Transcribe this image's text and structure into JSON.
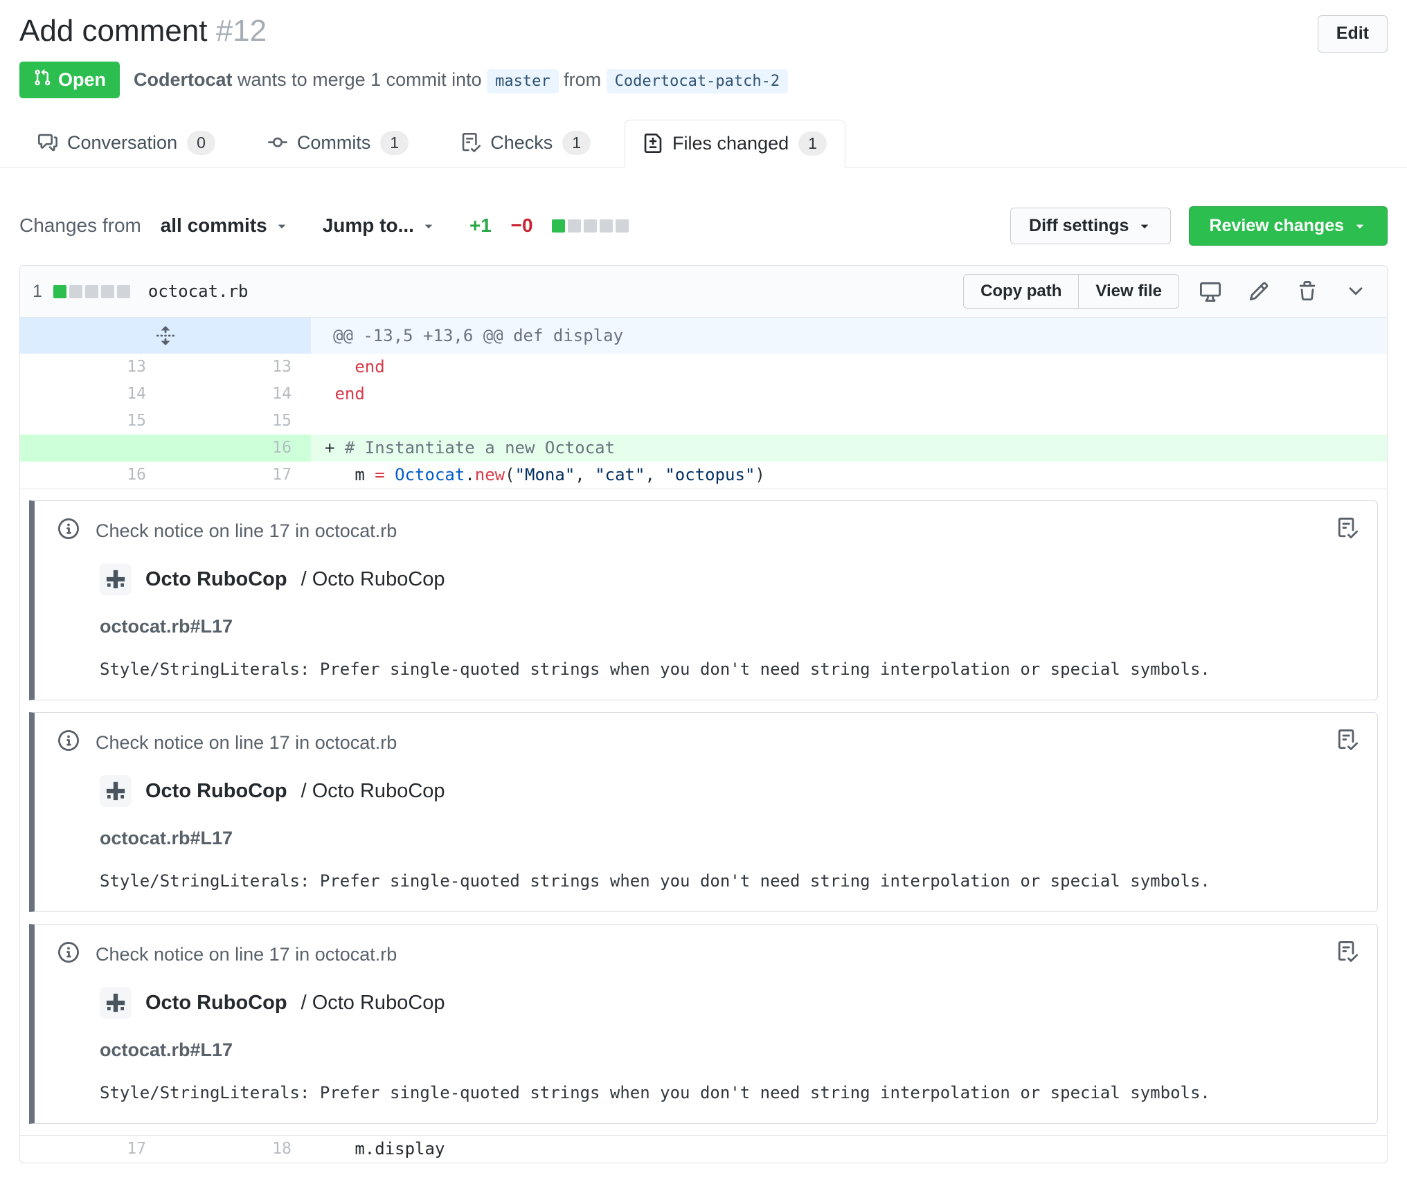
{
  "header": {
    "title": "Add comment",
    "number": "#12",
    "edit_button": "Edit",
    "state_label": "Open",
    "meta": {
      "author": "Codertocat",
      "text_middle": " wants to merge 1 commit into ",
      "base_branch": "master",
      "text_from": " from ",
      "head_branch": "Codertocat-patch-2"
    }
  },
  "tabs": [
    {
      "label": "Conversation",
      "count": "0",
      "icon": "comment-discussion",
      "active": false
    },
    {
      "label": "Commits",
      "count": "1",
      "icon": "git-commit",
      "active": false
    },
    {
      "label": "Checks",
      "count": "1",
      "icon": "checklist",
      "active": false
    },
    {
      "label": "Files changed",
      "count": "1",
      "icon": "file-diff",
      "active": true
    }
  ],
  "toolbar": {
    "changes_from_label": "Changes from",
    "changes_from_value": "all commits",
    "jump_to": "Jump to...",
    "additions": "+1",
    "deletions": "−0",
    "diff_blocks": {
      "added": 1,
      "total": 5
    },
    "diff_settings": "Diff settings",
    "review_changes": "Review changes"
  },
  "file": {
    "changed_count": "1",
    "blocks": {
      "added": 1,
      "total": 5
    },
    "name": "octocat.rb",
    "copy_path": "Copy path",
    "view_file": "View file"
  },
  "diff": {
    "hunk": {
      "header": "@@ -13,5 +13,6 @@ def display"
    },
    "rows": [
      {
        "type": "context",
        "old": "13",
        "new": "13",
        "tokens": [
          {
            "t": "   ",
            "c": "fg"
          },
          {
            "t": "end",
            "c": "kw"
          }
        ]
      },
      {
        "type": "context",
        "old": "14",
        "new": "14",
        "tokens": [
          {
            "t": " ",
            "c": "fg"
          },
          {
            "t": "end",
            "c": "kw"
          }
        ]
      },
      {
        "type": "context",
        "old": "15",
        "new": "15",
        "tokens": []
      },
      {
        "type": "add",
        "old": "",
        "new": "16",
        "tokens": [
          {
            "t": "+ ",
            "c": "fg"
          },
          {
            "t": "# Instantiate a new Octocat",
            "c": "com"
          }
        ]
      },
      {
        "type": "context",
        "old": "16",
        "new": "17",
        "tokens": [
          {
            "t": "   m ",
            "c": "fg"
          },
          {
            "t": "=",
            "c": "kw"
          },
          {
            "t": " ",
            "c": "fg"
          },
          {
            "t": "Octocat",
            "c": "const"
          },
          {
            "t": ".",
            "c": "fg"
          },
          {
            "t": "new",
            "c": "kw"
          },
          {
            "t": "(",
            "c": "fg"
          },
          {
            "t": "\"Mona\"",
            "c": "str"
          },
          {
            "t": ", ",
            "c": "fg"
          },
          {
            "t": "\"cat\"",
            "c": "str"
          },
          {
            "t": ", ",
            "c": "fg"
          },
          {
            "t": "\"octopus\"",
            "c": "str"
          },
          {
            "t": ")",
            "c": "fg"
          }
        ]
      }
    ],
    "tail": {
      "type": "context",
      "old": "17",
      "new": "18",
      "tokens": [
        {
          "t": "   m.display",
          "c": "fg"
        }
      ]
    }
  },
  "notices": [
    {
      "header": "Check notice on line 17 in octocat.rb",
      "app_name": "Octo RuboCop",
      "app_suffix": " / Octo RuboCop",
      "path": "octocat.rb#L17",
      "message": "Style/StringLiterals: Prefer single-quoted strings when you don't need string interpolation or special symbols."
    },
    {
      "header": "Check notice on line 17 in octocat.rb",
      "app_name": "Octo RuboCop",
      "app_suffix": " / Octo RuboCop",
      "path": "octocat.rb#L17",
      "message": "Style/StringLiterals: Prefer single-quoted strings when you don't need string interpolation or special symbols."
    },
    {
      "header": "Check notice on line 17 in octocat.rb",
      "app_name": "Octo RuboCop",
      "app_suffix": " / Octo RuboCop",
      "path": "octocat.rb#L17",
      "message": "Style/StringLiterals: Prefer single-quoted strings when you don't need string interpolation or special symbols."
    }
  ],
  "colors": {
    "open_green": "#2cbe4e",
    "additions_green": "#28a745",
    "deletions_red": "#cb2431",
    "added_line_bg": "#e6ffed",
    "added_num_bg": "#cdffd8",
    "hunk_gutter_bg": "#dbedff",
    "hunk_bg": "#f1f8ff",
    "branch_bg": "#eaf5ff",
    "notice_bar": "#6a737d",
    "keyword_red": "#d73a49",
    "constant_blue": "#005cc5",
    "string_navy": "#032f62"
  }
}
